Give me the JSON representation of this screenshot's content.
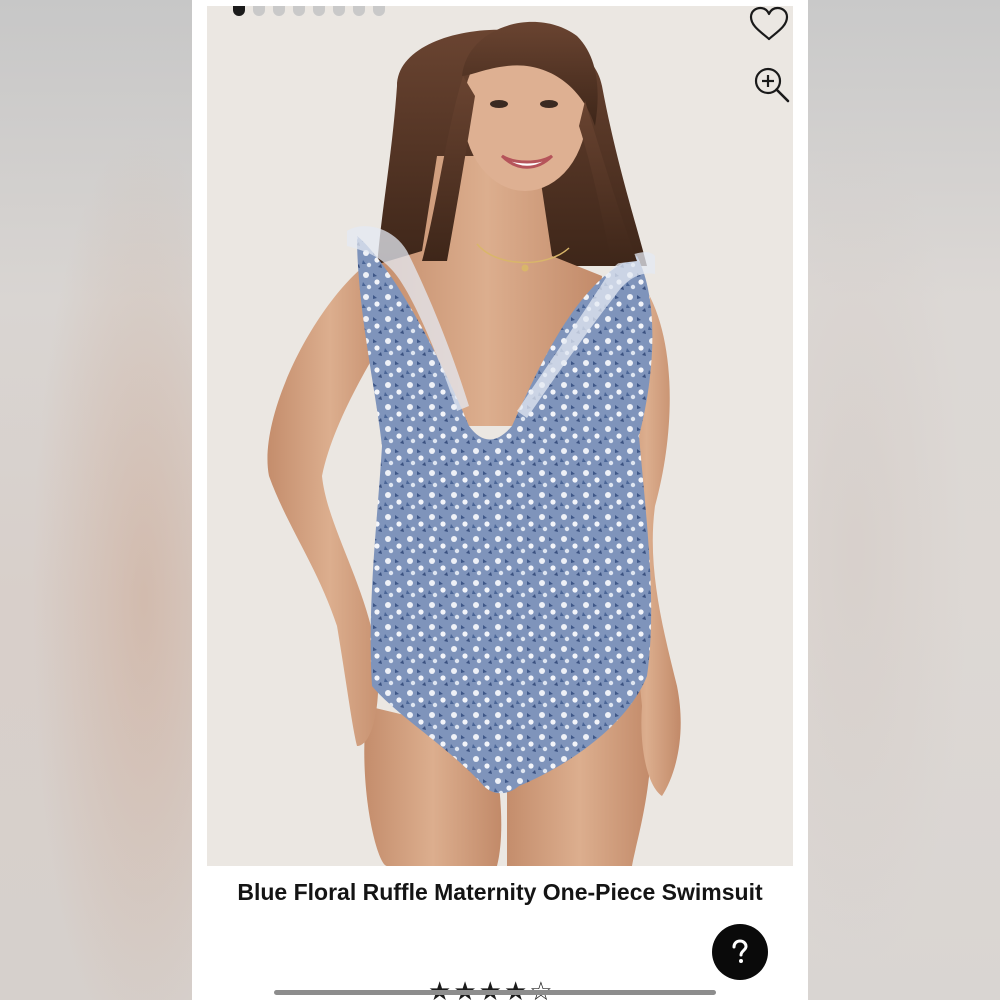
{
  "carousel": {
    "slide_count": 8,
    "active_index": 0
  },
  "product": {
    "title": "Blue Floral Ruffle Maternity One-Piece Swimsuit",
    "rating": 4,
    "rating_max": 5
  },
  "icons": {
    "favorite": "heart-icon",
    "zoom": "zoom-in-icon",
    "help": "question-icon"
  },
  "colors": {
    "swimsuit": "#8ea2c4",
    "accent": "#0a0a0a"
  }
}
